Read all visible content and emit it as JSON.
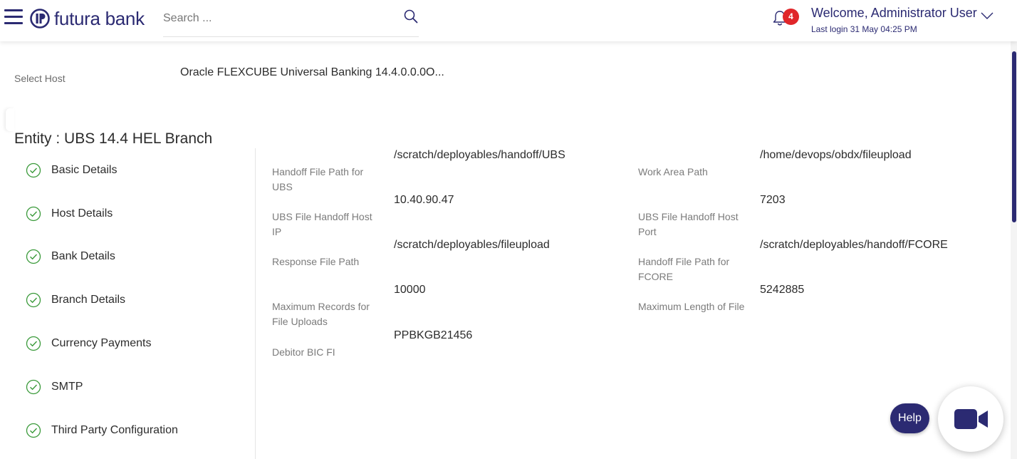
{
  "header": {
    "brand": "futura bank",
    "search_placeholder": "Search ...",
    "notification_count": "4",
    "welcome": "Welcome, Administrator User",
    "last_login": "Last login 31 May 04:25 PM"
  },
  "host": {
    "label": "Select Host",
    "value": "Oracle FLEXCUBE Universal Banking 14.4.0.0.0O..."
  },
  "entity_title": "Entity : UBS 14.4 HEL Branch",
  "steps": [
    {
      "label": "Basic Details"
    },
    {
      "label": "Host Details"
    },
    {
      "label": "Bank Details"
    },
    {
      "label": "Branch Details"
    },
    {
      "label": "Currency Payments"
    },
    {
      "label": "SMTP"
    },
    {
      "label": "Third Party Configuration"
    }
  ],
  "fields": [
    {
      "label": "Handoff File Path for UBS",
      "value": "/scratch/deployables/handoff/UBS"
    },
    {
      "label": "Work Area Path",
      "value": "/home/devops/obdx/fileupload"
    },
    {
      "label": "UBS File Handoff Host IP",
      "value": "10.40.90.47"
    },
    {
      "label": "UBS File Handoff Host Port",
      "value": "7203"
    },
    {
      "label": "Response File Path",
      "value": "/scratch/deployables/fileupload"
    },
    {
      "label": "Handoff File Path for FCORE",
      "value": "/scratch/deployables/handoff/FCORE"
    },
    {
      "label": "Maximum Records for File Uploads",
      "value": "10000"
    },
    {
      "label": "Maximum Length of File",
      "value": "5242885"
    },
    {
      "label": "Debitor BIC FI",
      "value": "PPBKGB21456"
    }
  ],
  "help_label": "Help",
  "colors": {
    "brand": "#2b2a72",
    "check": "#3a9a3a",
    "badge": "#e0262a"
  }
}
